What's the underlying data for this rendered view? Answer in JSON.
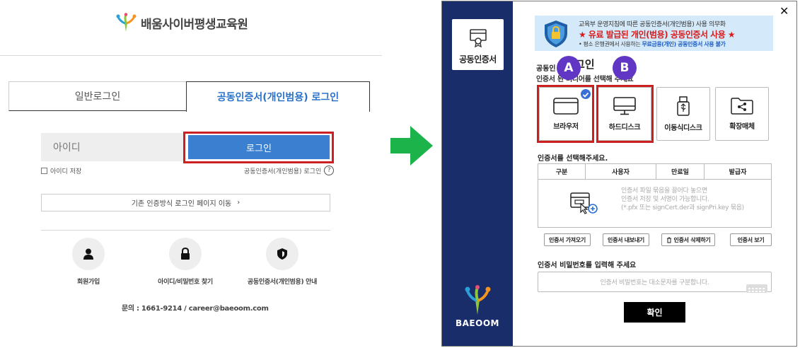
{
  "left": {
    "site_name": "배움사이버평생교육원",
    "tabs": [
      {
        "label": "일반로그인"
      },
      {
        "label": "공동인증서(개인범용) 로그인"
      }
    ],
    "id_placeholder": "아이디",
    "login_button": "로그인",
    "save_id": "아이디 저장",
    "cert_login_link": "공동인증서(개인범용) 로그인",
    "help_icon": "?",
    "old_login": "기존 인증방식 로그인 페이지 이동",
    "old_login_arrow": "›",
    "shortcuts": [
      {
        "label": "회원가입",
        "icon": "user-icon"
      },
      {
        "label": "아이디/비밀번호 찾기",
        "icon": "lock-icon"
      },
      {
        "label": "공동인증서(개인범용) 안내",
        "icon": "shield-icon"
      }
    ],
    "contact": "문의 : 1661-9214 / career@baeoom.com"
  },
  "colors": {
    "accent_blue": "#3a7fd0",
    "highlight_red": "#cc1f1f",
    "sidebar_navy": "#1a2d6b",
    "badge_purple": "#6236c4",
    "arrow_green": "#1bb34a"
  },
  "dialog": {
    "close": "✕",
    "sidebar_card_label": "공동인증서",
    "sidebar_logo": "BAEOOM",
    "banner": {
      "line1": "교육부 운영지침에 따른 공동인증서(개인범용) 사용 의무화",
      "line2": "★ 유료 발급된 개인(범용) 공동인증서 사용 ★",
      "line3_pre": "• 평소 은행권에서 사용하는 ",
      "line3_bold": "무료금융(개인) 공동인증서 사용 불가"
    },
    "title_small": "공동인",
    "title_big": "그인",
    "subtitle": "인증서         된 미디어를 선택해 주세요",
    "badges": [
      "A",
      "B"
    ],
    "media": [
      {
        "label": "브라우저",
        "icon": "browser-icon"
      },
      {
        "label": "하드디스크",
        "icon": "monitor-icon"
      },
      {
        "label": "이동식디스크",
        "icon": "usb-icon"
      },
      {
        "label": "확장매체",
        "icon": "folder-share-icon"
      }
    ],
    "select_title": "인증서를 선택해주세요.",
    "table_headers": [
      "구분",
      "사용자",
      "만료일",
      "발급자"
    ],
    "drop_text": [
      "인증서 파일 묶음을 끌어다 놓으면",
      "인증서 저장 및 서명이 가능합니다.",
      "(*.pfx 또는 signCert.der과 signPri.key 묶음)"
    ],
    "buttons": [
      "인증서 가져오기",
      "인증서 내보내기",
      "인증서 삭제하기",
      "인증서 보기"
    ],
    "pw_title": "인증서 비밀번호를 입력해 주세요",
    "pw_placeholder": "인증서 비밀번호는 대소문자를 구분합니다.",
    "ok": "확인"
  }
}
